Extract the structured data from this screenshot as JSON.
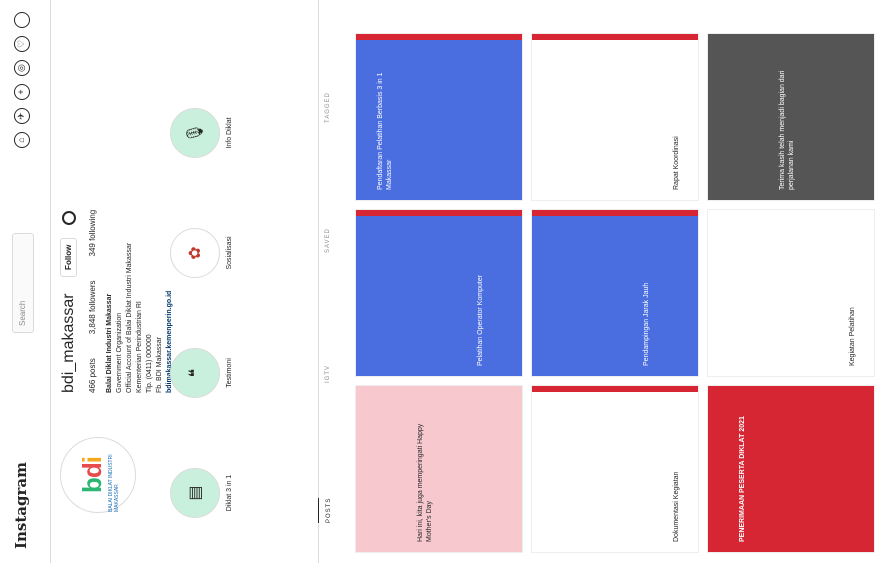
{
  "app": {
    "logo_text": "Instagram"
  },
  "search": {
    "placeholder": "Search"
  },
  "profile": {
    "username": "bdi_makassar",
    "follow_label": "Follow",
    "stats": {
      "posts": "466 posts",
      "followers": "3,848 followers",
      "following": "349 following"
    },
    "bio": {
      "name": "Balai Diklat Industri Makassar",
      "lines": [
        "Government Organization",
        "Official Account of Balai Diklat Industri Makassar",
        "Kementerian Perindustrian RI",
        "Tlp. (0411) 000000",
        "Fb. BDI Makassar"
      ],
      "link": "bdimakassar.kemenperin.go.id"
    },
    "avatar": {
      "letters": [
        "b",
        "d",
        "i"
      ],
      "subtitle": "BALAI DIKLAT INDUSTRI MAKASSAR"
    }
  },
  "highlights": [
    {
      "label": "Diklat 3 in 1",
      "icon": "book-icon"
    },
    {
      "label": "Testimoni",
      "icon": "quote-icon"
    },
    {
      "label": "Sosialisasi",
      "icon": "flower-icon"
    },
    {
      "label": "Info Diklat",
      "icon": "mic-icon"
    }
  ],
  "tabs": [
    {
      "label": "POSTS",
      "active": true
    },
    {
      "label": "IGTV",
      "active": false
    },
    {
      "label": "SAVED",
      "active": false
    },
    {
      "label": "TAGGED",
      "active": false
    }
  ],
  "posts": [
    {
      "bg": "#f7c9cf",
      "text": "Hari ini, kita juga memperingati Happy Mother's Day"
    },
    {
      "bg": "#4a6de0",
      "text": "Pelatihan Operator Komputer"
    },
    {
      "bg": "#4a6de0",
      "text": "Pendaftaran Pelatihan Berbasis 3 in 1 Makassar"
    },
    {
      "bg": "#ffffff",
      "text": "Dokumentasi Kegiatan"
    },
    {
      "bg": "#4a6de0",
      "text": "Pendampingan Jarak Jauh"
    },
    {
      "bg": "#ffffff",
      "text": "Rapat Koordinasi"
    },
    {
      "bg": "#d62633",
      "text": "PENERIMAAN PESERTA DIKLAT 2021"
    },
    {
      "bg": "#ffffff",
      "text": "Kegiatan Pelatihan"
    },
    {
      "bg": "#555555",
      "text": "Terima kasih telah menjadi bagian dari perjalanan kami"
    }
  ],
  "colors": {
    "accent": "#d62633",
    "brand_blue": "#4a6de0",
    "border": "#dbdbdb"
  }
}
